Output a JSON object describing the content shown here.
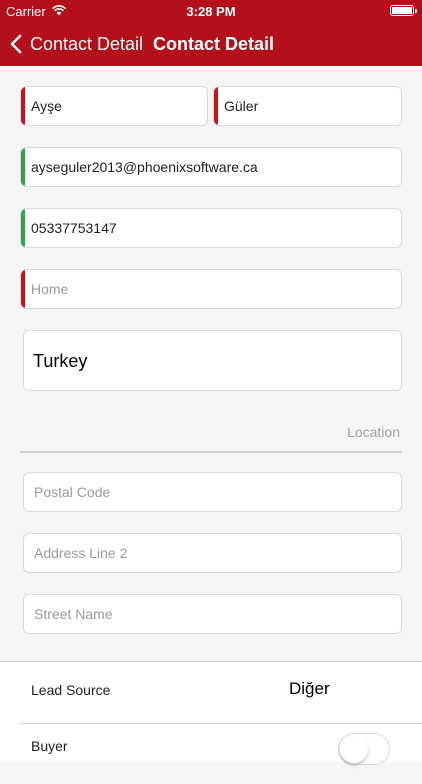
{
  "status_bar": {
    "carrier": "Carrier",
    "time": "3:28 PM",
    "battery_level": 1.0
  },
  "nav": {
    "back_label": "Contact Detail",
    "title": "Contact Detail"
  },
  "colors": {
    "brand": "#b3101b",
    "required_bar": "#d0101c",
    "valid_bar": "#2aa84a"
  },
  "form": {
    "first_name": {
      "value": "Ayşe",
      "status": "required"
    },
    "last_name": {
      "value": "Güler",
      "status": "required"
    },
    "email": {
      "value": "ayseguler2013@phoenixsoftware.ca",
      "status": "valid"
    },
    "phone": {
      "value": "05337753147",
      "status": "valid"
    },
    "home": {
      "value": "",
      "placeholder": "Home",
      "status": "required"
    },
    "country": "Turkey",
    "location_label": "Location",
    "postal_code": {
      "value": "",
      "placeholder": "Postal Code"
    },
    "address_line_2": {
      "value": "",
      "placeholder": "Address Line 2"
    },
    "street_name": {
      "value": "",
      "placeholder": "Street Name"
    }
  },
  "details": {
    "lead_source_label": "Lead Source",
    "lead_source_value": "Diğer",
    "buyer_label": "Buyer",
    "buyer_on": false
  }
}
